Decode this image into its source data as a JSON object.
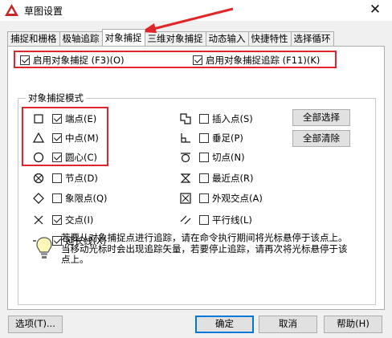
{
  "window": {
    "title": "草图设置",
    "close_glyph": "✕"
  },
  "tabs": [
    {
      "label": "捕捉和栅格"
    },
    {
      "label": "极轴追踪"
    },
    {
      "label": "对象捕捉"
    },
    {
      "label": "三维对象捕捉"
    },
    {
      "label": "动态输入"
    },
    {
      "label": "快捷特性"
    },
    {
      "label": "选择循环"
    }
  ],
  "top_options": {
    "enable_osnap": {
      "label": "启用对象捕捉 (F3)(O)",
      "checked": true
    },
    "enable_tracking": {
      "label": "启用对象捕捉追踪 (F11)(K)",
      "checked": true
    }
  },
  "group": {
    "legend": "对象捕捉模式"
  },
  "modes_left": [
    {
      "icon": "endpoint-icon",
      "label": "端点(E)",
      "checked": true
    },
    {
      "icon": "midpoint-icon",
      "label": "中点(M)",
      "checked": true
    },
    {
      "icon": "center-icon",
      "label": "圆心(C)",
      "checked": true
    },
    {
      "icon": "node-icon",
      "label": "节点(D)",
      "checked": false
    },
    {
      "icon": "quadrant-icon",
      "label": "象限点(Q)",
      "checked": false
    },
    {
      "icon": "intersection-icon",
      "label": "交点(I)",
      "checked": true
    },
    {
      "icon": "extension-icon",
      "label": "延长线(X)",
      "checked": true
    }
  ],
  "modes_right": [
    {
      "icon": "insertion-icon",
      "label": "插入点(S)",
      "checked": false
    },
    {
      "icon": "perpendicular-icon",
      "label": "垂足(P)",
      "checked": false
    },
    {
      "icon": "tangent-icon",
      "label": "切点(N)",
      "checked": false
    },
    {
      "icon": "nearest-icon",
      "label": "最近点(R)",
      "checked": false
    },
    {
      "icon": "apparent-intersection-icon",
      "label": "外观交点(A)",
      "checked": false
    },
    {
      "icon": "parallel-icon",
      "label": "平行线(L)",
      "checked": false
    }
  ],
  "side_buttons": {
    "select_all": "全部选择",
    "clear_all": "全部清除"
  },
  "hint": "若要从对象捕捉点进行追踪，请在命令执行期间将光标悬停于该点上。当移动光标时会出现追踪矢量，若要停止追踪，请再次将光标悬停于该点上。",
  "footer": {
    "options": "选项(T)...",
    "ok": "确定",
    "cancel": "取消",
    "help": "帮助(H)"
  },
  "colors": {
    "highlight_red": "#e0262a",
    "accent_blue": "#0078d7"
  }
}
